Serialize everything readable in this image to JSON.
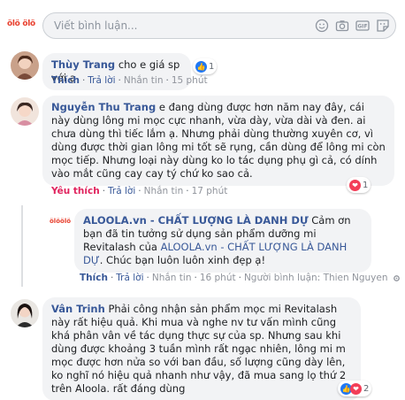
{
  "compose": {
    "brand": "ölö ölö",
    "placeholder": "Viết bình luận..."
  },
  "comments": [
    {
      "author": "Thùy Trang",
      "text": "cho e giá sp với ạ",
      "reaction_count": "1",
      "actions": {
        "like": "Thích",
        "reply": "Trả lời",
        "message": "Nhắn tin",
        "time": "15 phút"
      }
    },
    {
      "author": "Nguyễn Thu Trang",
      "text": "e đang dùng được hơn năm nay đây, cái này dùng lông mi mọc cực nhanh, vừa dày, vừa dài và đen. ai chưa dùng thì tiếc lắm ạ. Nhưng phải dùng thường xuyên cơ, vì dùng được thời gian lông mi tốt sẽ rụng, cần dùng để lông mi còn mọc tiếp. Nhưng loại này dùng ko lo tác dụng phụ gì cả, có dính vào mắt cũng cay cay tý chứ ko sao cả.",
      "reaction_count": "1",
      "actions": {
        "like": "Yêu thích",
        "reply": "Trả lời",
        "message": "Nhắn tin",
        "time": "17 phút"
      }
    },
    {
      "author": "ALOOLA.vn - CHẤT LƯỢNG LÀ DANH DỰ",
      "text_pre": "Cảm ơn bạn đã tin tưởng sử dụng sản phẩm dưỡng mi Revitalash của ",
      "text_link": "ALOOLA.vn - CHẤT LƯỢNG LÀ DANH DỰ",
      "text_post": ". Chúc bạn luôn luôn xinh đẹp ạ!",
      "actions": {
        "like": "Thích",
        "reply": "Trả lời",
        "message": "Nhắn tin",
        "time": "16 phút",
        "edited_by": "Người bình luận: Thien Nguyen"
      }
    },
    {
      "author": "Vân Trinh",
      "text": "Phải công nhận sản phẩm mọc mi Revitalash này rất hiệu quả. Khi mua và nghe nv tư vấn mình cũng khá phân vân về tác dụng thực sự của sp. Nhưng sau khi dùng được khoảng 3 tuần mình rất ngạc nhiên, lông mi m mọc được hơn nửa so với ban đầu, số lượng cũng dày lên, ko nghĩ nó hiệu quả nhanh như vậy, đã mua sang lọ thứ 2 trên Aloola. rất đáng dùng",
      "reaction_count": "2"
    }
  ],
  "colors": {
    "link": "#385898",
    "bubble": "#f2f3f5",
    "love": "#e0245e",
    "like_icon": "#2078f4",
    "heart_icon": "#f33e58"
  }
}
